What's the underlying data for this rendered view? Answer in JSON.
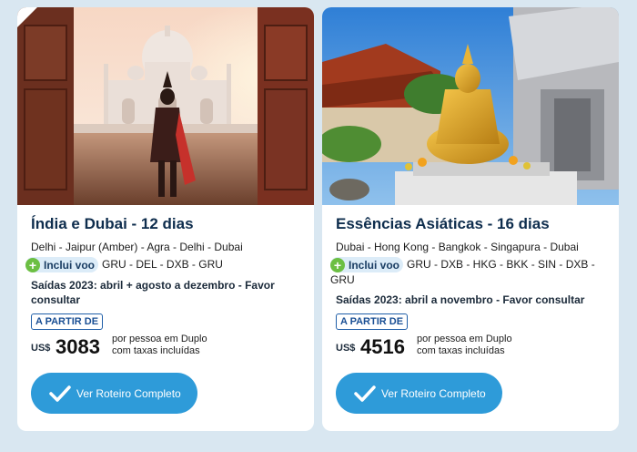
{
  "colors": {
    "page_bg": "#d9e7f1",
    "title": "#0e2d4d",
    "button": "#2e9bd9",
    "plus": "#6cbf43",
    "pill_bg": "#dcecf8",
    "badge_border": "#1f5ea8"
  },
  "cards": [
    {
      "image": "taj-mahal-photo",
      "title": "Índia e Dubai - 12 dias",
      "route": "Delhi - Jaipur (Amber) - Agra - Delhi - Dubai",
      "flight_label": "Inclui voo",
      "flight_route": "GRU - DEL - DXB - GRU",
      "dates": "Saídas 2023: abril + agosto a dezembro - Favor consultar",
      "from_label": "A PARTIR DE",
      "currency": "US$",
      "price": "3083",
      "price_note_1": "por pessoa em Duplo",
      "price_note_2": "com taxas incluídas",
      "button_label": "Ver Roteiro Completo"
    },
    {
      "image": "buddha-temple-photo",
      "title": "Essências Asiáticas - 16 dias",
      "route": "Dubai - Hong Kong - Bangkok - Singapura - Dubai",
      "flight_label": "Inclui voo",
      "flight_route": "GRU - DXB - HKG - BKK - SIN - DXB - GRU",
      "dates": "Saídas 2023: abril a novembro - Favor consultar",
      "from_label": "A PARTIR DE",
      "currency": "US$",
      "price": "4516",
      "price_note_1": "por pessoa em Duplo",
      "price_note_2": "com taxas incluídas",
      "button_label": "Ver Roteiro Completo"
    }
  ]
}
